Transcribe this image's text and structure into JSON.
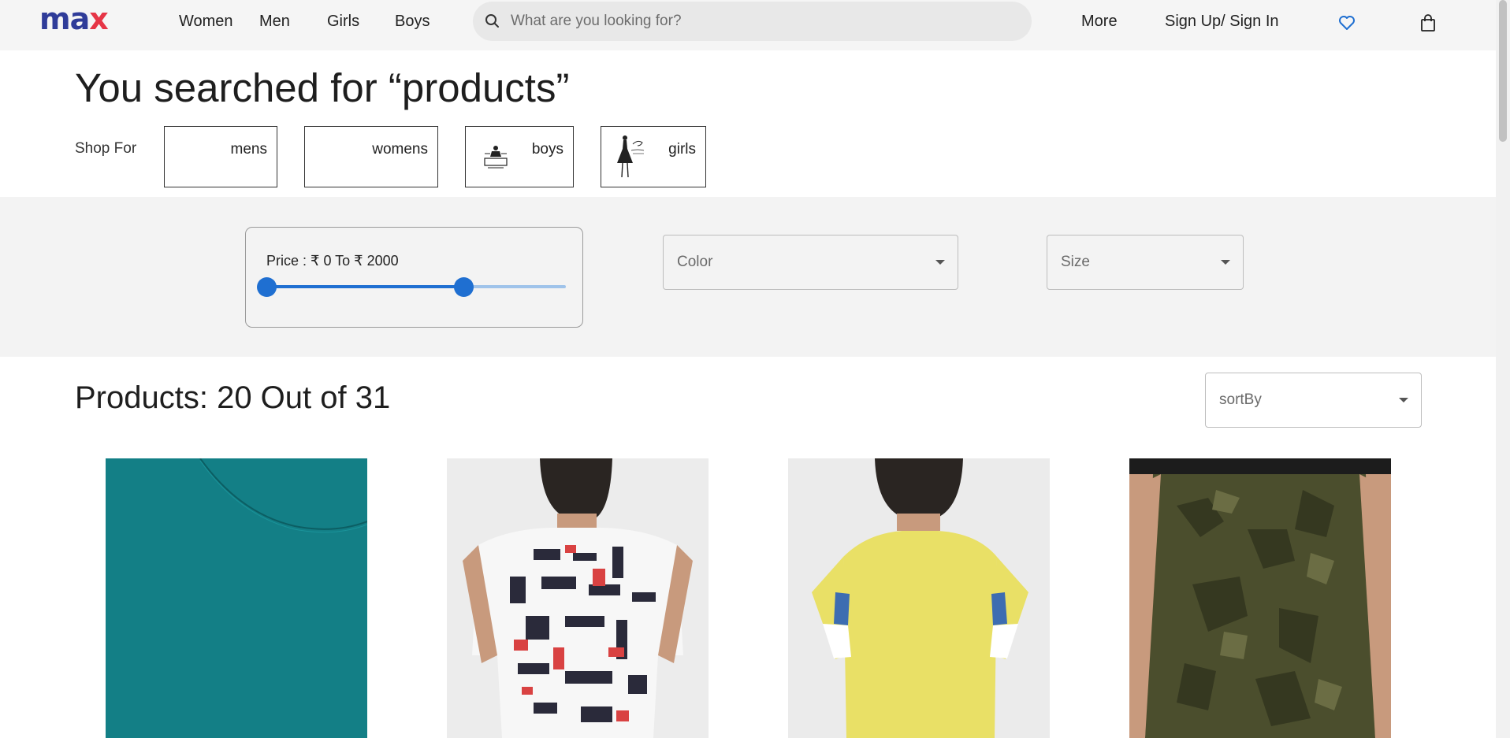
{
  "header": {
    "logo": {
      "left": "ma",
      "right": "x"
    },
    "nav": [
      "Women",
      "Men",
      "Girls",
      "Boys"
    ],
    "search_placeholder": "What are you looking for?",
    "more": "More",
    "sign_in": "Sign Up/ Sign In"
  },
  "search_result": {
    "title": "You searched for “products”",
    "shop_for_label": "Shop For",
    "chips": [
      "mens",
      "womens",
      "boys",
      "girls"
    ]
  },
  "filters": {
    "price_label": "Price : ₹ 0 To ₹ 2000",
    "price_min": 0,
    "price_max": 2000,
    "slider_fraction_low": 0,
    "slider_fraction_high": 0.66,
    "color_label": "Color",
    "size_label": "Size"
  },
  "products": {
    "count_label": "Products: 20 Out of 31",
    "sort_label": "sortBy"
  },
  "colors": {
    "accent": "#1f6fd1",
    "logo_blue": "#2f3c99",
    "logo_red": "#e63546"
  }
}
